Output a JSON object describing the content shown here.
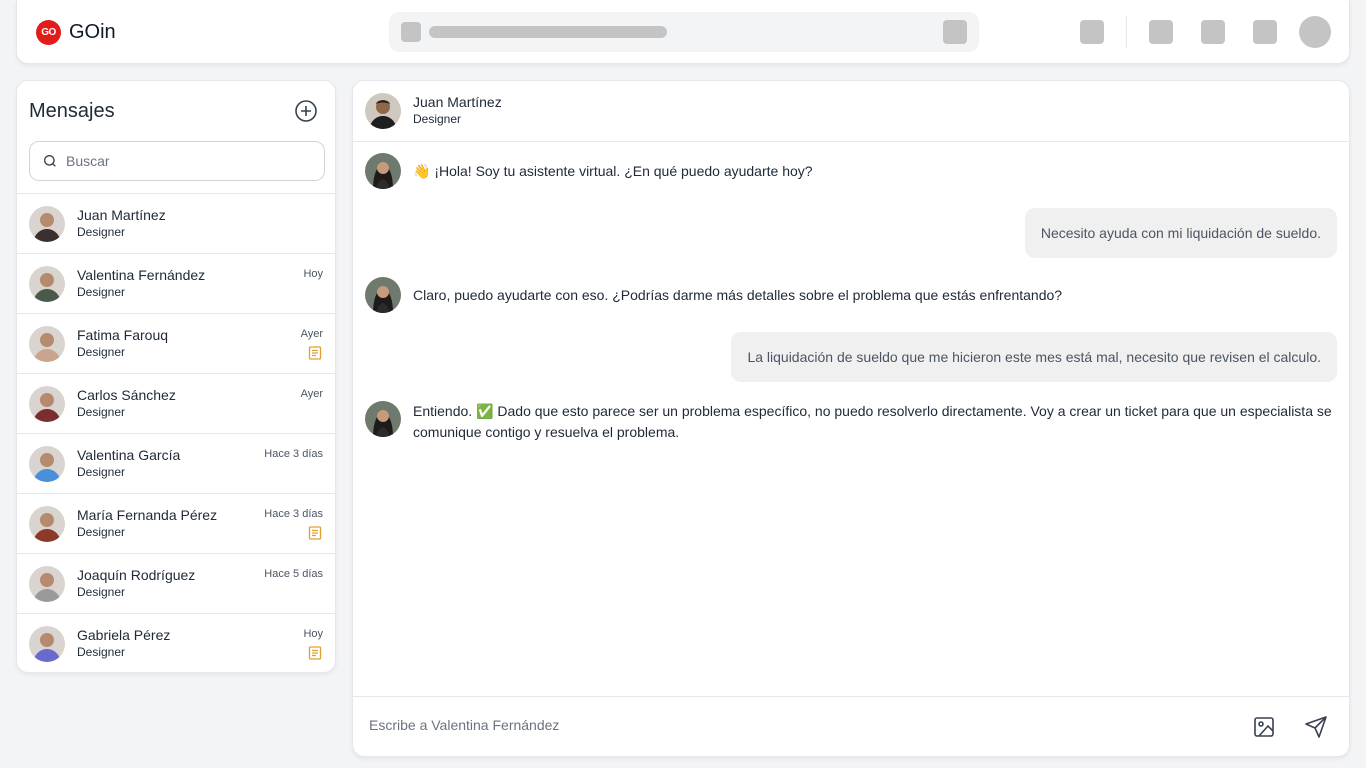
{
  "app": {
    "logo_mark": "GO",
    "name": "GOin",
    "accent": "#e21b1b"
  },
  "sidebar": {
    "title": "Mensajes",
    "search_placeholder": "Buscar",
    "contacts": [
      {
        "name": "Juan Martínez",
        "role": "Designer",
        "time": "",
        "note": false,
        "avatar_color": "#3b2f2f"
      },
      {
        "name": "Valentina Fernández",
        "role": "Designer",
        "time": "Hoy",
        "note": false,
        "avatar_color": "#4a5a4a"
      },
      {
        "name": "Fatima Farouq",
        "role": "Designer",
        "time": "Ayer",
        "note": true,
        "avatar_color": "#c9a48e"
      },
      {
        "name": "Carlos Sánchez",
        "role": "Designer",
        "time": "Ayer",
        "note": false,
        "avatar_color": "#7a2e2e"
      },
      {
        "name": "Valentina García",
        "role": "Designer",
        "time": "Hace 3 días",
        "note": false,
        "avatar_color": "#4a90d9"
      },
      {
        "name": "María Fernanda Pérez",
        "role": "Designer",
        "time": "Hace 3 días",
        "note": true,
        "avatar_color": "#8b3a2a"
      },
      {
        "name": "Joaquín Rodríguez",
        "role": "Designer",
        "time": "Hace 5 días",
        "note": false,
        "avatar_color": "#9a9a9a"
      },
      {
        "name": "Gabriela Pérez",
        "role": "Designer",
        "time": "Hoy",
        "note": true,
        "avatar_color": "#6a6acd"
      }
    ]
  },
  "chat": {
    "header": {
      "name": "Juan Martínez",
      "role": "Designer"
    },
    "messages": [
      {
        "from": "bot",
        "emoji": "👋",
        "text": "¡Hola! Soy tu asistente virtual. ¿En qué puedo ayudarte hoy?"
      },
      {
        "from": "user",
        "text": "Necesito ayuda con mi liquidación de sueldo."
      },
      {
        "from": "bot",
        "text": "Claro, puedo ayudarte con eso. ¿Podrías darme más detalles sobre el problema que estás enfrentando?"
      },
      {
        "from": "user",
        "text": "La liquidación de sueldo que me hicieron este mes está mal, necesito que revisen el calculo."
      },
      {
        "from": "bot",
        "text_before": "Entiendo.",
        "emoji": "✅",
        "text": "Dado que esto parece ser un problema específico, no puedo resolverlo directamente. Voy a crear un ticket para que un especialista se comunique contigo y resuelva el problema."
      }
    ],
    "composer_placeholder": "Escribe a Valentina Fernández"
  }
}
